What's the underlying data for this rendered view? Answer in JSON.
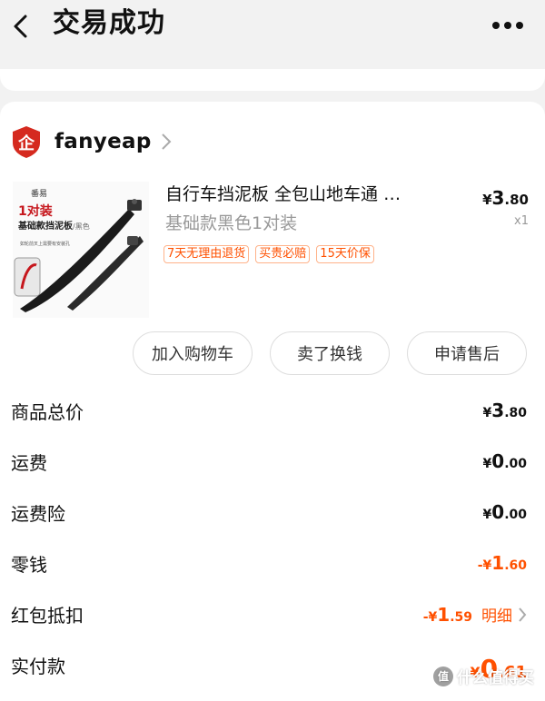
{
  "header": {
    "title": "交易成功"
  },
  "shop": {
    "name": "fanyeap"
  },
  "product": {
    "title": "自行车挡泥板 全包山地车通 …",
    "spec": "基础款黑色1对装",
    "price_symbol": "¥",
    "price_int": "3",
    "price_dec": ".80",
    "quantity": "x1",
    "tags": [
      "7天无理由退货",
      "买贵必赔",
      "15天价保"
    ],
    "image": {
      "brand": "番易",
      "tag": "1对装",
      "subtitle": "基础款挡泥板",
      "subtitle_small": "/黑色",
      "note": "如轮前叉上需要有安装孔"
    }
  },
  "actions": [
    "加入购物车",
    "卖了换钱",
    "申请售后"
  ],
  "summary": [
    {
      "label": "商品总价",
      "sign": "",
      "sym": "¥",
      "int": "3",
      "dec": ".80",
      "color": "black"
    },
    {
      "label": "运费",
      "sign": "",
      "sym": "¥",
      "int": "0",
      "dec": ".00",
      "color": "black"
    },
    {
      "label": "运费险",
      "sign": "",
      "sym": "¥",
      "int": "0",
      "dec": ".00",
      "color": "black"
    },
    {
      "label": "零钱",
      "sign": "-",
      "sym": "¥",
      "int": "1",
      "dec": ".60",
      "color": "orange"
    },
    {
      "label": "红包抵扣",
      "sign": "-",
      "sym": "¥",
      "int": "1",
      "dec": ".59",
      "color": "orange",
      "link": "明细"
    },
    {
      "label": "实付款",
      "sign": "",
      "sym": "¥",
      "int": "0",
      "dec": ".61",
      "color": "orange"
    }
  ],
  "watermark": {
    "icon": "值",
    "text": "什么值得买"
  },
  "colors": {
    "accent": "#ff5000",
    "background": "#f2f2f2",
    "logo_red": "#d52a1f"
  },
  "icons": {
    "back": "chevron-left-icon",
    "more": "more-dots-icon",
    "shop_logo": "shield-logo-icon",
    "chevron": "chevron-right-icon"
  }
}
